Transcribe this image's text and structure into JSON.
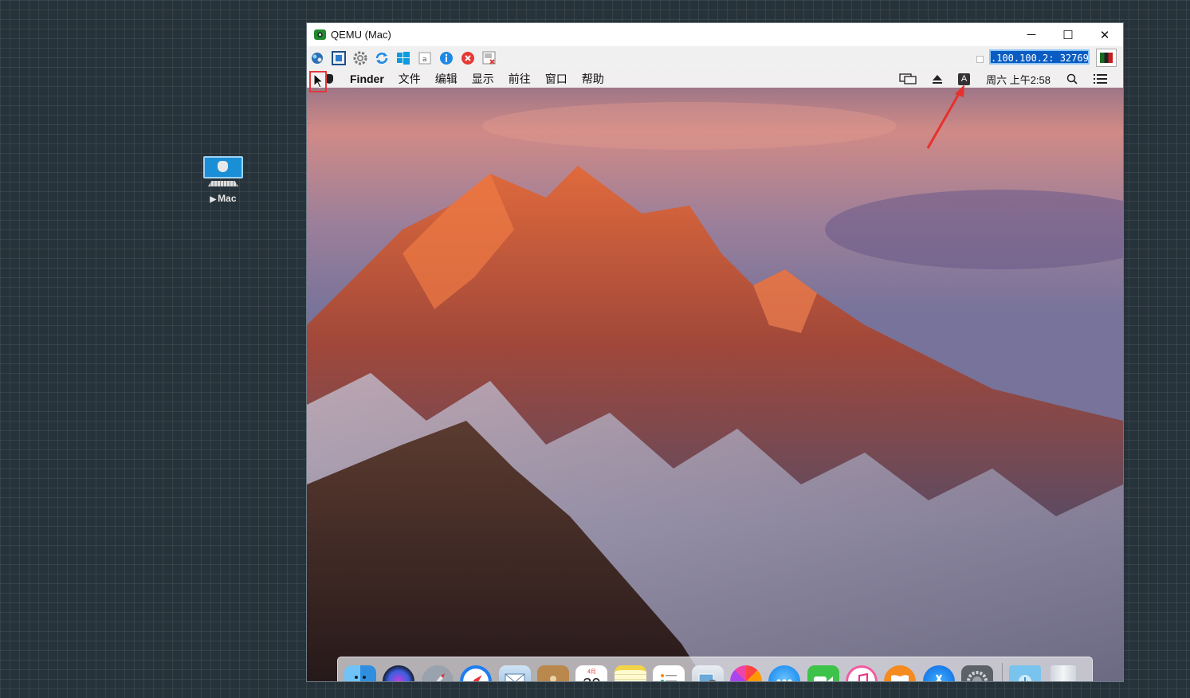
{
  "desktop": {
    "node_label": "Mac",
    "node_play_glyph": "▶"
  },
  "window": {
    "title": "QEMU (Mac)",
    "controls": {
      "minimize": "─",
      "maximize": "☐",
      "close": "✕"
    }
  },
  "toolbar": {
    "icons": [
      "network-icon",
      "fullscreen-icon",
      "settings-gear-icon",
      "refresh-icon",
      "windows-icon",
      "keyboard-icon",
      "info-icon",
      "stop-icon",
      "screenshot-icon"
    ],
    "address": ".100.100.2: 32769"
  },
  "mac": {
    "menubar": {
      "app": "Finder",
      "items": [
        "文件",
        "编辑",
        "显示",
        "前往",
        "窗口",
        "帮助"
      ],
      "input_method": "A",
      "clock": "周六 上午2:58"
    },
    "calendar": {
      "month": "4月",
      "day": "30"
    },
    "dock_icons": [
      "finder-icon",
      "siri-icon",
      "launchpad-icon",
      "safari-icon",
      "mail-icon",
      "contacts-icon",
      "calendar-icon",
      "notes-icon",
      "reminders-icon",
      "preview-icon",
      "photos-icon",
      "messages-icon",
      "facetime-icon",
      "itunes-icon",
      "ibooks-icon",
      "app-store-icon",
      "system-preferences-icon",
      "downloads-folder-icon",
      "trash-icon"
    ]
  },
  "colors": {
    "desktop_bg": "#27333a",
    "address_bg": "#0a5cc2",
    "highlight_red": "#e5383b"
  }
}
